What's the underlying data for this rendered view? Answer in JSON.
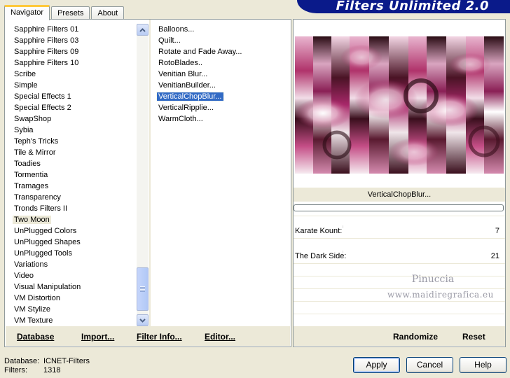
{
  "title": "Filters Unlimited 2.0",
  "tabs": [
    "Navigator",
    "Presets",
    "About"
  ],
  "categories": [
    "Sapphire Filters 01",
    "Sapphire Filters 03",
    "Sapphire Filters 09",
    "Sapphire Filters 10",
    "Scribe",
    "Simple",
    "Special Effects 1",
    "Special Effects 2",
    "SwapShop",
    "Sybia",
    "Teph's Tricks",
    "Tile & Mirror",
    "Toadies",
    "Tormentia",
    "Tramages",
    "Transparency",
    "Tronds Filters II",
    "Two Moon",
    "UnPlugged Colors",
    "UnPlugged Shapes",
    "UnPlugged Tools",
    "Variations",
    "Video",
    "Visual Manipulation",
    "VM Distortion",
    "VM Stylize",
    "VM Texture"
  ],
  "selected_category": "Two Moon",
  "filters": [
    "Balloons...",
    "Quilt...",
    "Rotate and Fade Away...",
    "RotoBlades..",
    "Venitian Blur...",
    "VenitianBuilder...",
    "VerticalChopBlur...",
    "VerticalRipplie...",
    "WarmCloth..."
  ],
  "selected_filter": "VerticalChopBlur...",
  "links": {
    "database": "Database",
    "import": "Import...",
    "filter_info": "Filter Info...",
    "editor": "Editor..."
  },
  "preview": {
    "filter_name": "VerticalChopBlur...",
    "watermark_line1": "Pinuccia",
    "watermark_line2": "www.maidiregrafica.eu"
  },
  "params": [
    {
      "label": "Karate Kount:",
      "value": "7"
    },
    {
      "label": "The Dark Side:",
      "value": "21"
    }
  ],
  "actions": {
    "randomize": "Randomize",
    "reset": "Reset"
  },
  "info": {
    "database_label": "Database:",
    "database_value": "ICNET-Filters",
    "filters_label": "Filters:",
    "filters_value": "1318"
  },
  "buttons": {
    "apply": "Apply",
    "cancel": "Cancel",
    "help": "Help"
  },
  "colors": {
    "selection": "#316ac5",
    "banner": "#0a1a8a",
    "preview_accent": "#b0336b"
  }
}
